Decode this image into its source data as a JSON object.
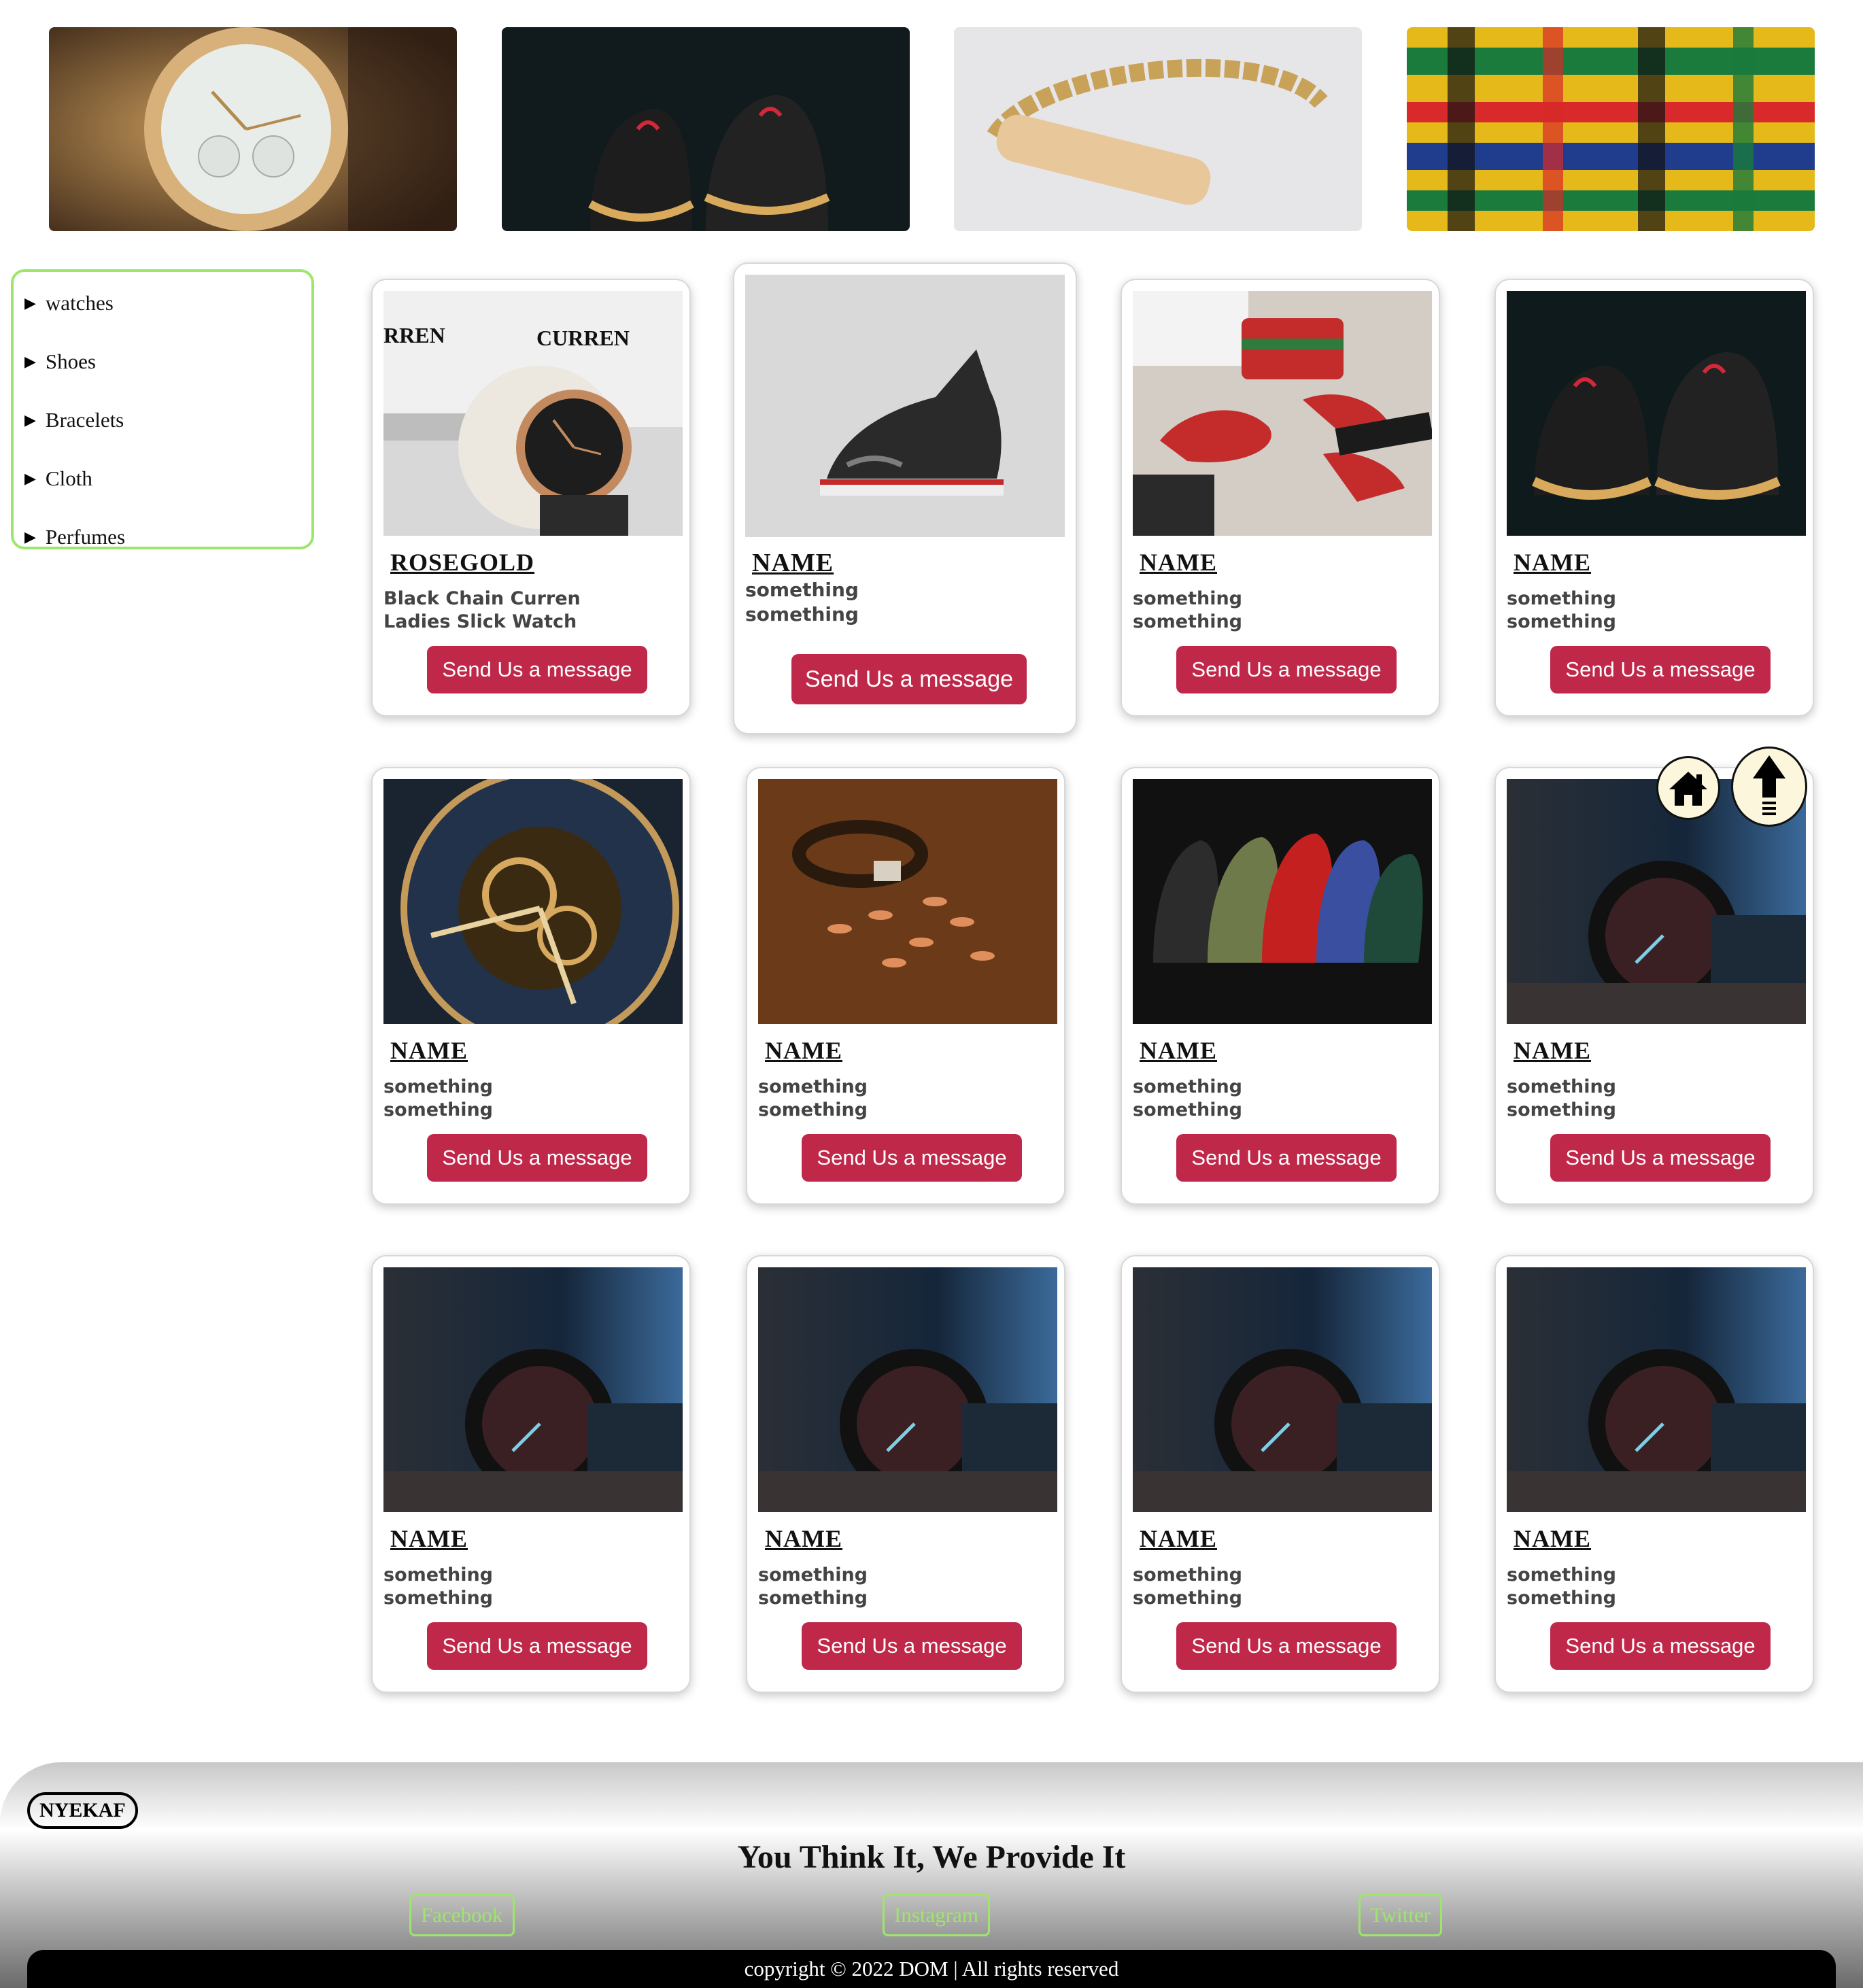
{
  "banner": {
    "images": [
      "watch-photo",
      "sneakers-photo",
      "gold-bracelet-photo",
      "kente-cloth-photo"
    ]
  },
  "sidebar": {
    "items": [
      {
        "label": "watches"
      },
      {
        "label": "Shoes"
      },
      {
        "label": "Bracelets"
      },
      {
        "label": "Cloth"
      },
      {
        "label": "Perfumes"
      }
    ]
  },
  "products": [
    {
      "title": "ROSEGOLD",
      "desc1": "Black Chain Curren",
      "desc2": "Ladies Slick Watch",
      "button": "Send Us a message"
    },
    {
      "title": "NAME",
      "desc1": "something",
      "desc2": "something",
      "button": "Send Us a message"
    },
    {
      "title": "NAME",
      "desc1": "something",
      "desc2": "something",
      "button": "Send Us a message"
    },
    {
      "title": "NAME",
      "desc1": "something",
      "desc2": "something",
      "button": "Send Us a message"
    },
    {
      "title": "NAME",
      "desc1": "something",
      "desc2": "something",
      "button": "Send Us a message"
    },
    {
      "title": "NAME",
      "desc1": "something",
      "desc2": "something",
      "button": "Send Us a message"
    },
    {
      "title": "NAME",
      "desc1": "something",
      "desc2": "something",
      "button": "Send Us a message"
    },
    {
      "title": "NAME",
      "desc1": "something",
      "desc2": "something",
      "button": "Send Us a message"
    },
    {
      "title": "NAME",
      "desc1": "something",
      "desc2": "something",
      "button": "Send Us a message"
    },
    {
      "title": "NAME",
      "desc1": "something",
      "desc2": "something",
      "button": "Send Us a message"
    },
    {
      "title": "NAME",
      "desc1": "something",
      "desc2": "something",
      "button": "Send Us a message"
    },
    {
      "title": "NAME",
      "desc1": "something",
      "desc2": "something",
      "button": "Send Us a message"
    }
  ],
  "curren_box_text": {
    "left": "RREN",
    "right": "CURREN"
  },
  "floating": {
    "home": "home-icon",
    "top": "arrow-up-icon"
  },
  "footer": {
    "brand": "NYEKAF",
    "tagline": "You Think It, We Provide It",
    "links": [
      {
        "label": "Facebook"
      },
      {
        "label": "Instagram"
      },
      {
        "label": "Twitter"
      }
    ],
    "copyright": "copyright © 2022 DOM | All rights reserved",
    "link_color": "#9ee66b"
  },
  "colors": {
    "button": "#c0284a",
    "sidebar_border": "#9ee66b"
  }
}
